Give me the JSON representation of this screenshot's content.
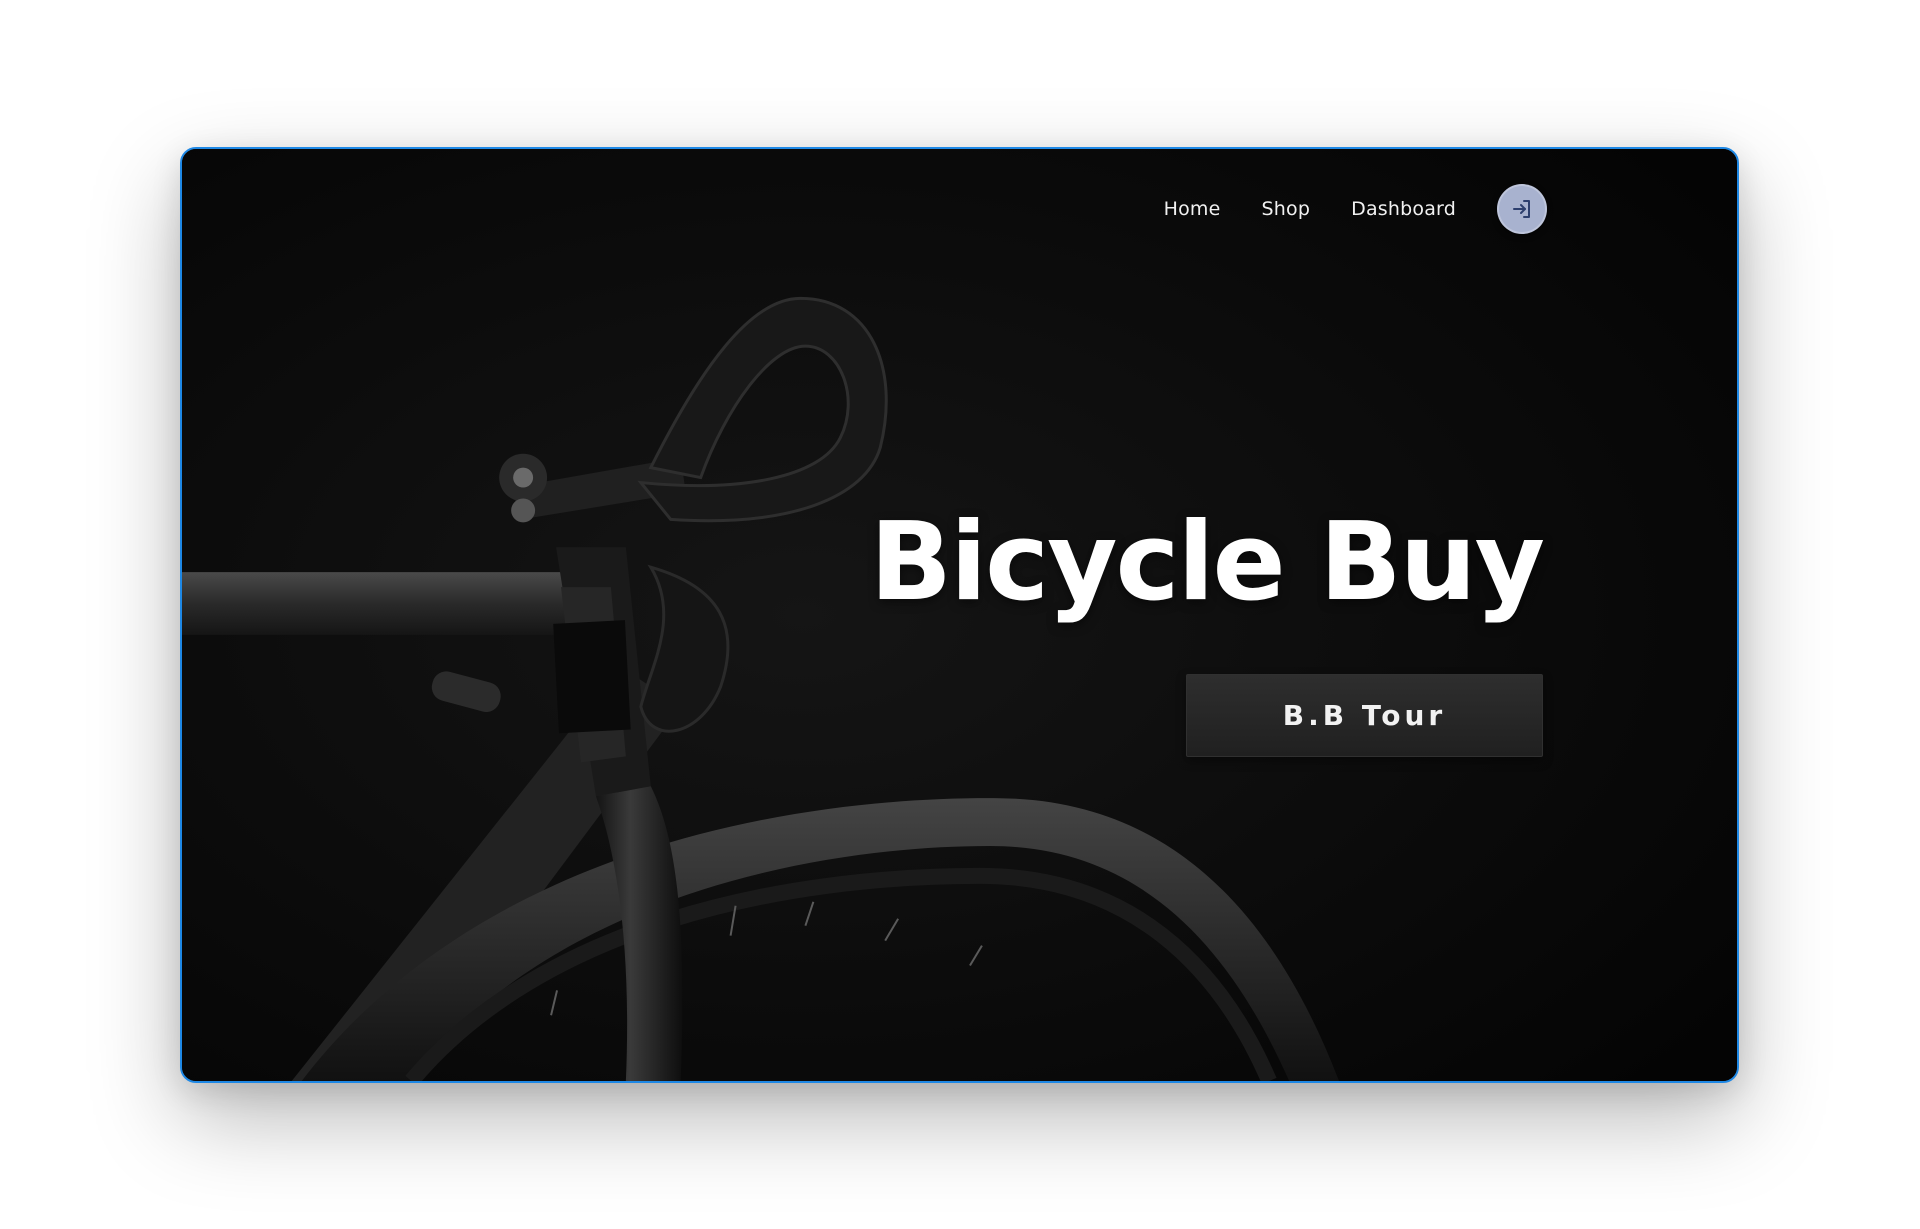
{
  "nav": {
    "links": [
      {
        "label": "Home"
      },
      {
        "label": "Shop"
      },
      {
        "label": "Dashboard"
      }
    ],
    "login_icon": "login-arrow-icon"
  },
  "hero": {
    "title": "Bicycle Buy",
    "cta_label": "B.B Tour",
    "background": "black-and-white road bicycle photo"
  },
  "colors": {
    "card_border": "#1e88e5",
    "background": "#060606",
    "login_button": "#a8b2cf",
    "cta_background": "#262626",
    "text": "#ffffff"
  }
}
